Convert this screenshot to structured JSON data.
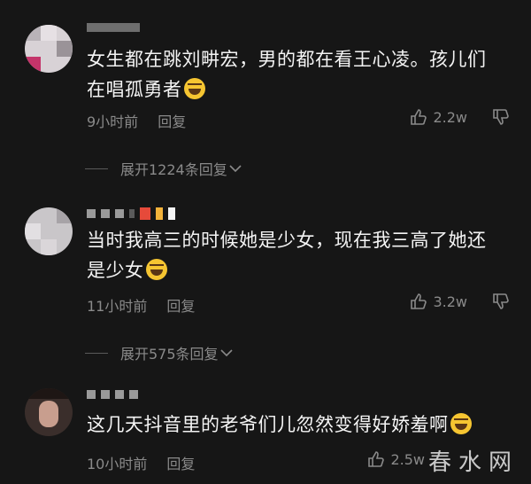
{
  "comments": [
    {
      "text": "女生都在跳刘畊宏，男的都在看王心凌。孩儿们在唱孤勇者",
      "time": "9小时前",
      "reply": "回复",
      "likes": "2.2w",
      "expand": "展开1224条回复"
    },
    {
      "text": "当时我高三的时候她是少女，现在我三高了她还是少女",
      "time": "11小时前",
      "reply": "回复",
      "likes": "3.2w",
      "expand": "展开575条回复"
    },
    {
      "text": "这几天抖音里的老爷们儿忽然变得好娇羞啊",
      "time": "10小时前",
      "reply": "回复",
      "likes": "2.5w"
    }
  ],
  "watermark": "春水网",
  "colors": {
    "background": "#161616",
    "text": "#f4f4f4",
    "meta": "#8a8a8a"
  },
  "icons": [
    "thumb-up-icon",
    "thumb-down-icon",
    "chevron-down-icon",
    "laughing-emoji-icon"
  ]
}
